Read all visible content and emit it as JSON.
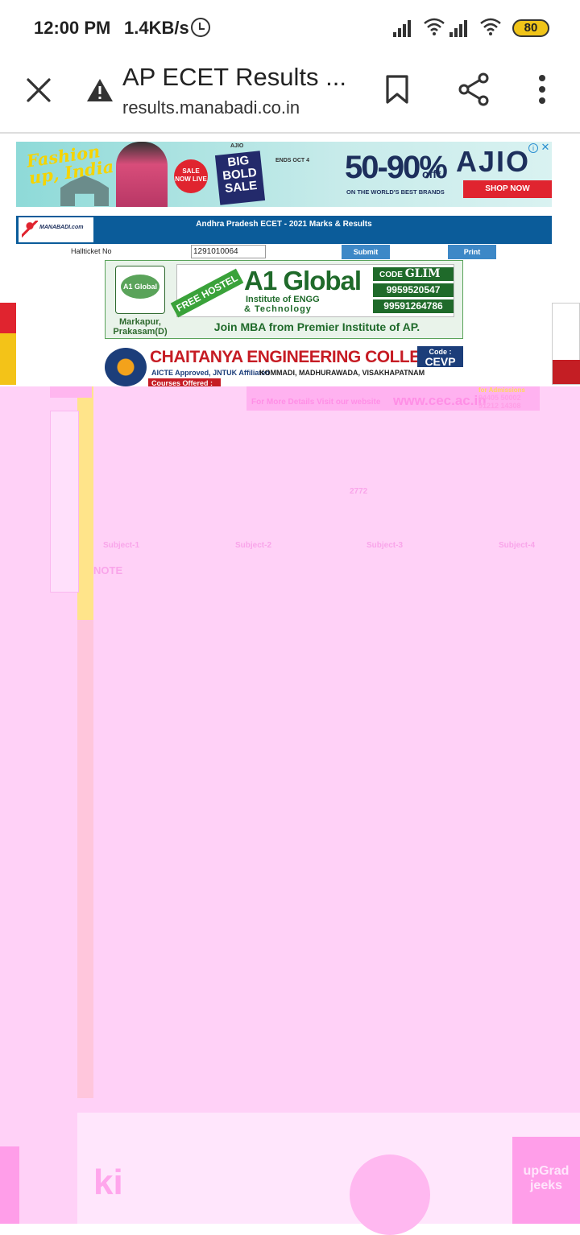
{
  "status_bar": {
    "time": "12:00 PM",
    "speed": "1.4KB/s",
    "battery": "80"
  },
  "toolbar": {
    "title": "AP ECET Results ...",
    "url": "results.manabadi.co.in"
  },
  "ad1": {
    "slogan": "Fashion up, India",
    "sale_badge": "SALE NOW LIVE",
    "brand_small": "AJIO",
    "sale_title": "BIG BOLD SALE",
    "ends": "ENDS OCT 4",
    "discount": "50-90%",
    "off": "off*",
    "tagline": "ON THE WORLD'S BEST BRANDS",
    "brand": "AJIO",
    "cta": "SHOP NOW"
  },
  "banner": {
    "heading": "Andhra Pradesh ECET - 2021 Marks & Results",
    "logo_text": "MANABADI.com"
  },
  "form": {
    "label": "Hallticket No",
    "value": "1291010064",
    "submit": "Submit",
    "print": "Print"
  },
  "a1_ad": {
    "logo": "A1 Global",
    "ribbon": "FREE HOSTEL",
    "name": "A1 Global",
    "sub1": "Institute of ENGG",
    "sub2": "& Technology",
    "code_label": "CODE",
    "code": "GLIM",
    "phone1": "9959520547",
    "phone2": "99591264786",
    "location": "Markapur, Prakasam(D)",
    "footer": "Join MBA from Premier Institute of AP."
  },
  "cec_ad": {
    "name": "CHAITANYA ENGINEERING COLLEGE",
    "code_label": "Code :",
    "code": "CEVP",
    "sub": "AICTE Approved, JNTUK Affiliated",
    "address": "KOMMADI, MADHURAWADA, VISAKHAPATNAM",
    "courses": "Courses Offered :",
    "website_label": "For More Details Visit our website",
    "website": "www.cec.ac.in",
    "admissions": "for Admissions",
    "phone1": "94405 50002",
    "phone2": "91212 14308"
  },
  "pink_area": {
    "value": "2772",
    "subjects": [
      "Subject-1",
      "Subject-2",
      "Subject-3",
      "Subject-4"
    ],
    "note": "NOTE",
    "bottom_word": "ki",
    "bottom_brand": "upGrad jeeks"
  },
  "colors": {
    "banner_blue": "#0b5c9a",
    "pink_overlay": "#ffd1f7",
    "button_blue": "#3d88c7"
  }
}
